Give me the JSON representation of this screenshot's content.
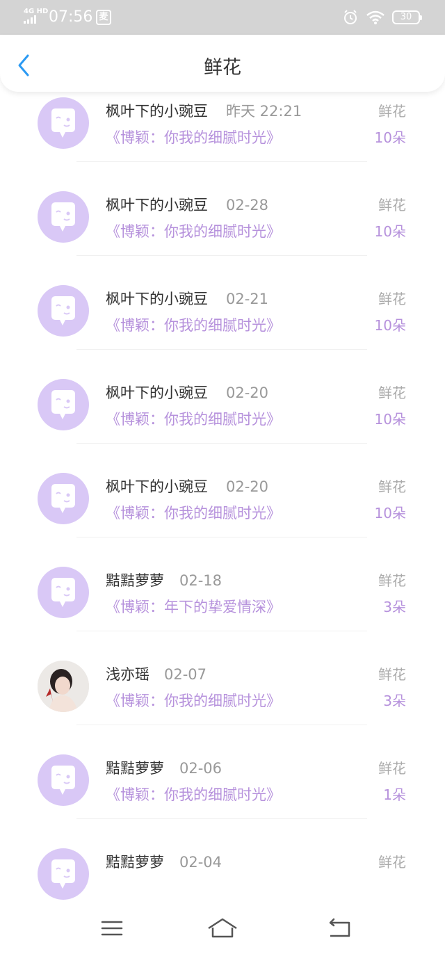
{
  "status_bar": {
    "network": "4G HD",
    "time": "07:56",
    "app_icon_text": "麦",
    "battery": "30",
    "icons": [
      "signal-icon",
      "alarm-icon",
      "wifi-icon",
      "battery-icon"
    ]
  },
  "header": {
    "title": "鲜花",
    "back_icon": "chevron-left-icon"
  },
  "colors": {
    "accent_blue": "#2b9af3",
    "purple_text": "#b691dc",
    "avatar_bg": "#d9c8f6"
  },
  "gifts": [
    {
      "name": "枫叶下的小豌豆",
      "date": "昨天 22:21",
      "work": "《博颖：你我的细腻时光》",
      "kind": "鲜花",
      "count": "10朵",
      "avatar": "chat-bubble-avatar"
    },
    {
      "name": "枫叶下的小豌豆",
      "date": "02-28",
      "work": "《博颖：你我的细腻时光》",
      "kind": "鲜花",
      "count": "10朵",
      "avatar": "chat-bubble-avatar"
    },
    {
      "name": "枫叶下的小豌豆",
      "date": "02-21",
      "work": "《博颖：你我的细腻时光》",
      "kind": "鲜花",
      "count": "10朵",
      "avatar": "chat-bubble-avatar"
    },
    {
      "name": "枫叶下的小豌豆",
      "date": "02-20",
      "work": "《博颖：你我的细腻时光》",
      "kind": "鲜花",
      "count": "10朵",
      "avatar": "chat-bubble-avatar"
    },
    {
      "name": "枫叶下的小豌豆",
      "date": "02-20",
      "work": "《博颖：你我的细腻时光》",
      "kind": "鲜花",
      "count": "10朵",
      "avatar": "chat-bubble-avatar"
    },
    {
      "name": "黠黠萝萝",
      "date": "02-18",
      "work": "《博颖：年下的挚爱情深》",
      "kind": "鲜花",
      "count": "3朵",
      "avatar": "chat-bubble-avatar"
    },
    {
      "name": "浅亦瑶",
      "date": "02-07",
      "work": "《博颖：你我的细腻时光》",
      "kind": "鲜花",
      "count": "3朵",
      "avatar": "user-photo-avatar"
    },
    {
      "name": "黠黠萝萝",
      "date": "02-06",
      "work": "《博颖：你我的细腻时光》",
      "kind": "鲜花",
      "count": "1朵",
      "avatar": "chat-bubble-avatar"
    },
    {
      "name": "黠黠萝萝",
      "date": "02-04",
      "work": "",
      "kind": "鲜花",
      "count": "",
      "avatar": "chat-bubble-avatar"
    }
  ],
  "nav_bar": {
    "icons": [
      "menu-icon",
      "home-icon",
      "back-icon"
    ]
  }
}
